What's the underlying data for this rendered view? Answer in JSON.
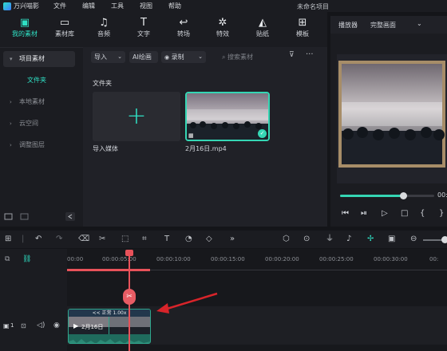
{
  "titlebar": {
    "app_name": "万兴喵影",
    "menus": [
      "文件",
      "编辑",
      "工具",
      "视图",
      "帮助"
    ],
    "project_title": "未命名项目"
  },
  "toolbar": {
    "tools": [
      {
        "label": "我的素材",
        "icon": "media-icon"
      },
      {
        "label": "素材库",
        "icon": "library-icon"
      },
      {
        "label": "音频",
        "icon": "audio-icon"
      },
      {
        "label": "文字",
        "icon": "text-icon"
      },
      {
        "label": "转场",
        "icon": "transition-icon"
      },
      {
        "label": "特效",
        "icon": "effects-icon"
      },
      {
        "label": "贴纸",
        "icon": "sticker-icon"
      },
      {
        "label": "模板",
        "icon": "template-icon"
      }
    ],
    "active_color": "#2fe0c4"
  },
  "sidebar": {
    "items": [
      {
        "label": "项目素材"
      },
      {
        "label": "文件夹"
      },
      {
        "label": "本地素材"
      },
      {
        "label": "云空间"
      },
      {
        "label": "调整图层"
      }
    ]
  },
  "media": {
    "import_label": "导入",
    "ai_label": "AI绘画",
    "record_label": "录制",
    "search_placeholder": "搜索素材",
    "folder_title": "文件夹",
    "import_media_label": "导入媒体",
    "video_file": "2月16日.mp4"
  },
  "player": {
    "tab_label": "播放器",
    "quality_label": "完整画面",
    "time": "00:",
    "progress": 0.67
  },
  "timeline": {
    "ruler_labels": [
      "00:00",
      "00:00:05:00",
      "00:00:10:00",
      "00:00:15:00",
      "00:00:20:00",
      "00:00:25:00",
      "00:00:30:00",
      "00:"
    ],
    "clip_speed_label": "<< 正常 1.00x",
    "clip_name": "2月16日",
    "track_number": "1"
  },
  "colors": {
    "accent": "#2fe0c4",
    "playhead": "#e8525a",
    "annotation_arrow": "#d8242a"
  }
}
